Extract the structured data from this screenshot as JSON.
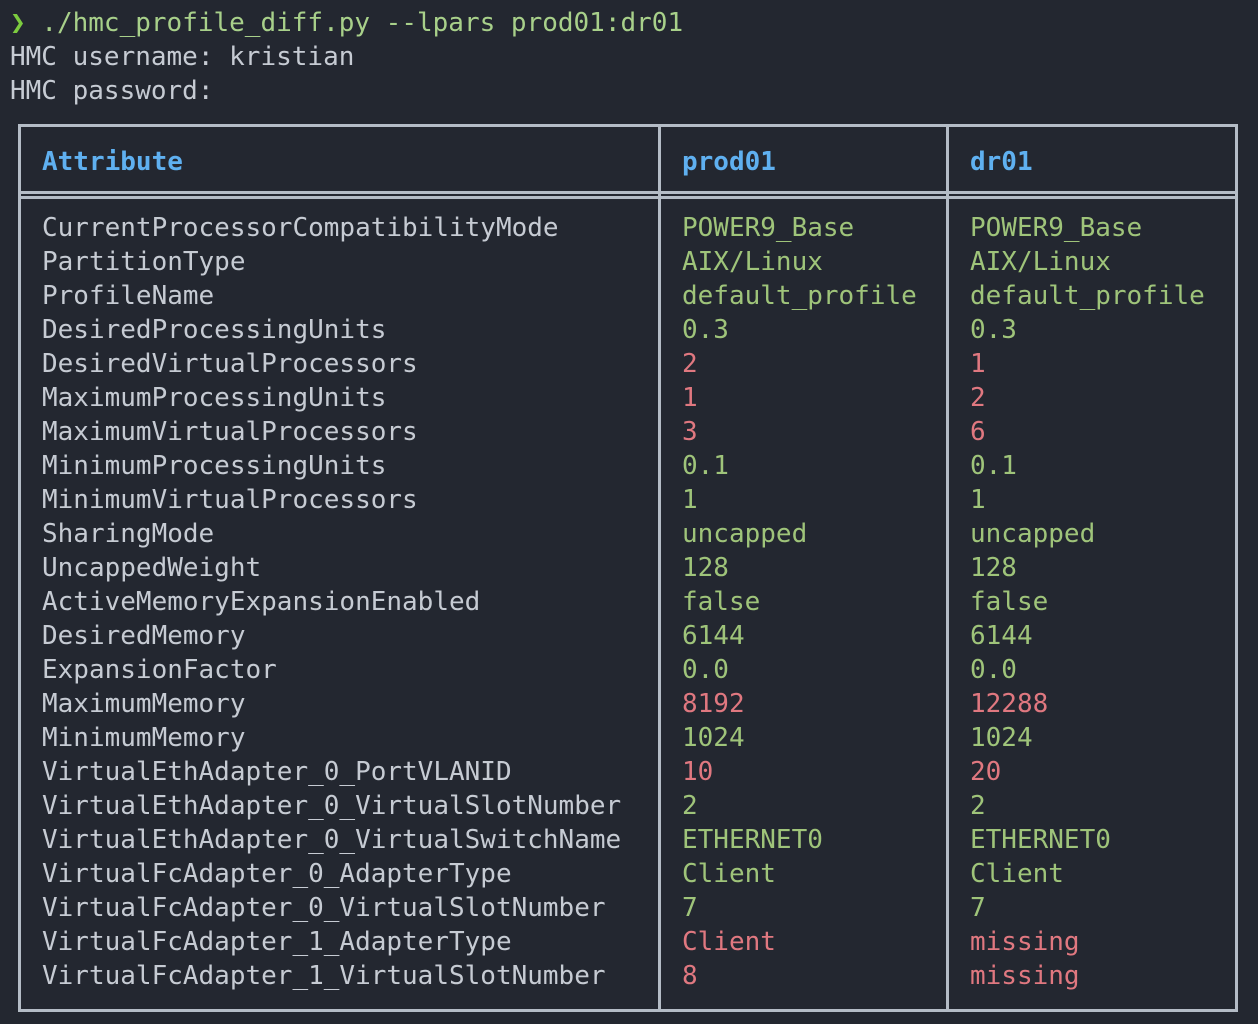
{
  "terminal": {
    "prompt_symbol": "❯",
    "command": "./hmc_profile_diff.py --lpars prod01:dr01",
    "username_prompt": "HMC username: kristian",
    "password_prompt": "HMC password:"
  },
  "colors": {
    "background": "#232730",
    "border": "#b4bcc6",
    "header": "#5fb0f0",
    "match": "#9fc47a",
    "mismatch": "#e07880",
    "prompt": "#7ccb3f"
  },
  "table": {
    "headers": {
      "attribute": "Attribute",
      "lpar_a": "prod01",
      "lpar_b": "dr01"
    },
    "rows": [
      {
        "attribute": "CurrentProcessorCompatibilityMode",
        "a": "POWER9_Base",
        "b": "POWER9_Base",
        "status": "same"
      },
      {
        "attribute": "PartitionType",
        "a": "AIX/Linux",
        "b": "AIX/Linux",
        "status": "same"
      },
      {
        "attribute": "ProfileName",
        "a": "default_profile",
        "b": "default_profile",
        "status": "same"
      },
      {
        "attribute": "DesiredProcessingUnits",
        "a": "0.3",
        "b": "0.3",
        "status": "same"
      },
      {
        "attribute": "DesiredVirtualProcessors",
        "a": "2",
        "b": "1",
        "status": "diff"
      },
      {
        "attribute": "MaximumProcessingUnits",
        "a": "1",
        "b": "2",
        "status": "diff"
      },
      {
        "attribute": "MaximumVirtualProcessors",
        "a": "3",
        "b": "6",
        "status": "diff"
      },
      {
        "attribute": "MinimumProcessingUnits",
        "a": "0.1",
        "b": "0.1",
        "status": "same"
      },
      {
        "attribute": "MinimumVirtualProcessors",
        "a": "1",
        "b": "1",
        "status": "same"
      },
      {
        "attribute": "SharingMode",
        "a": "uncapped",
        "b": "uncapped",
        "status": "same"
      },
      {
        "attribute": "UncappedWeight",
        "a": "128",
        "b": "128",
        "status": "same"
      },
      {
        "attribute": "ActiveMemoryExpansionEnabled",
        "a": "false",
        "b": "false",
        "status": "same"
      },
      {
        "attribute": "DesiredMemory",
        "a": "6144",
        "b": "6144",
        "status": "same"
      },
      {
        "attribute": "ExpansionFactor",
        "a": "0.0",
        "b": "0.0",
        "status": "same"
      },
      {
        "attribute": "MaximumMemory",
        "a": "8192",
        "b": "12288",
        "status": "diff"
      },
      {
        "attribute": "MinimumMemory",
        "a": "1024",
        "b": "1024",
        "status": "same"
      },
      {
        "attribute": "VirtualEthAdapter_0_PortVLANID",
        "a": "10",
        "b": "20",
        "status": "diff"
      },
      {
        "attribute": "VirtualEthAdapter_0_VirtualSlotNumber",
        "a": "2",
        "b": "2",
        "status": "same"
      },
      {
        "attribute": "VirtualEthAdapter_0_VirtualSwitchName",
        "a": "ETHERNET0",
        "b": "ETHERNET0",
        "status": "same"
      },
      {
        "attribute": "VirtualFcAdapter_0_AdapterType",
        "a": "Client",
        "b": "Client",
        "status": "same"
      },
      {
        "attribute": "VirtualFcAdapter_0_VirtualSlotNumber",
        "a": "7",
        "b": "7",
        "status": "same"
      },
      {
        "attribute": "VirtualFcAdapter_1_AdapterType",
        "a": "Client",
        "b": "missing",
        "status": "diff"
      },
      {
        "attribute": "VirtualFcAdapter_1_VirtualSlotNumber",
        "a": "8",
        "b": "missing",
        "status": "diff"
      }
    ]
  }
}
